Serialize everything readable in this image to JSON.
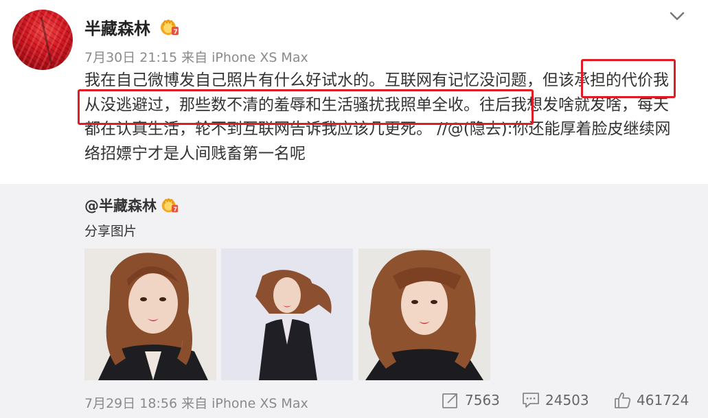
{
  "post": {
    "username": "半藏森林",
    "badge_icon": "crown-medal-icon",
    "meta": "7月30日 21:15 来自 iPhone XS Max",
    "content": "我在自己微博发自己照片有什么好试水的。互联网有记忆没问题，但该承担的代价我从没逃避过，那些数不清的羞辱和生活骚扰我照单全收。往后我想发啥就发啥，每天都在认真生活，轮不到互联网告诉我应该几更死。 //@(隐去):你还能厚着脸皮继续网络招嫖宁才是人间贱畜第一名呢",
    "highlight_color": "#e01b24"
  },
  "repost": {
    "username": "@半藏森林",
    "text": "分享图片",
    "time": "7月29日 18:56 来自 iPhone XS Max",
    "stats": {
      "shares": "7563",
      "comments": "24503",
      "likes": "461724"
    }
  },
  "colors": {
    "repost_background": "#f2f2f5",
    "meta_text": "#8a8a8a"
  }
}
